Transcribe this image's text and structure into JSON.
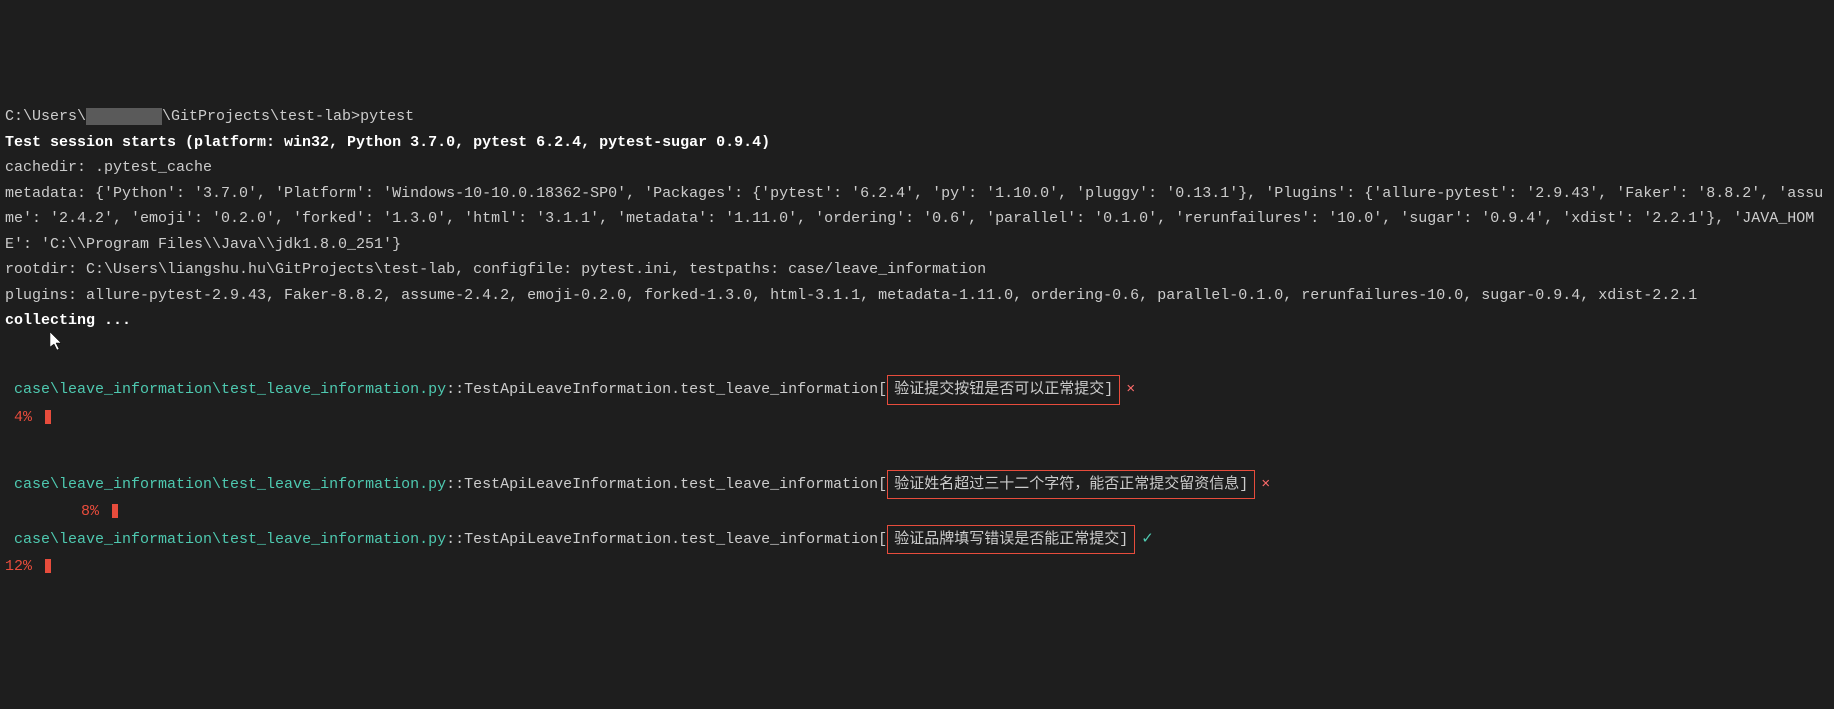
{
  "prompt": {
    "path_prefix": "C:\\Users\\",
    "redacted": "████████",
    "path_suffix": "\\GitProjects\\test-lab>",
    "command": "pytest"
  },
  "session_header": "Test session starts (platform: win32, Python 3.7.0, pytest 6.2.4, pytest-sugar 0.9.4)",
  "cachedir": "cachedir: .pytest_cache",
  "metadata": "metadata: {'Python': '3.7.0', 'Platform': 'Windows-10-10.0.18362-SP0', 'Packages': {'pytest': '6.2.4', 'py': '1.10.0', 'pluggy': '0.13.1'}, 'Plugins': {'allure-pytest': '2.9.43', 'Faker': '8.8.2', 'assume': '2.4.2', 'emoji': '0.2.0', 'forked': '1.3.0', 'html': '3.1.1', 'metadata': '1.11.0', 'ordering': '0.6', 'parallel': '0.1.0', 'rerunfailures': '10.0', 'sugar': '0.9.4', 'xdist': '2.2.1'}, 'JAVA_HOME': 'C:\\\\Program Files\\\\Java\\\\jdk1.8.0_251'}",
  "rootdir": "rootdir: C:\\Users\\liangshu.hu\\GitProjects\\test-lab, configfile: pytest.ini, testpaths: case/leave_information",
  "plugins": "plugins: allure-pytest-2.9.43, Faker-8.8.2, assume-2.4.2, emoji-0.2.0, forked-1.3.0, html-3.1.1, metadata-1.11.0, ordering-0.6, parallel-0.1.0, rerunfailures-10.0, sugar-0.9.4, xdist-2.2.1",
  "collecting": "collecting ...",
  "tests": [
    {
      "path": " case\\leave_information\\test_leave_information.py",
      "sep": "::",
      "name": "TestApiLeaveInformation.test_leave_information[",
      "param": "验证提交按钮是否可以正常提交",
      "closing": "]",
      "status": "fail",
      "mark": "×",
      "percent": " 4%",
      "indent_class": "indent-1"
    },
    {
      "path": " case\\leave_information\\test_leave_information.py",
      "sep": "::",
      "name": "TestApiLeaveInformation.test_leave_information[",
      "param": "验证姓名超过三十二个字符，能否正常提交留资信息",
      "closing": "]",
      "status": "fail",
      "mark": "×",
      "percent": "8%",
      "indent_class": "indent-2"
    },
    {
      "path": " case\\leave_information\\test_leave_information.py",
      "sep": "::",
      "name": "TestApiLeaveInformation.test_leave_information[",
      "param": "验证品牌填写错误是否能正常提交",
      "closing": "]",
      "status": "pass",
      "mark": "✓",
      "percent": "12%",
      "indent_class": "indent-1"
    }
  ]
}
